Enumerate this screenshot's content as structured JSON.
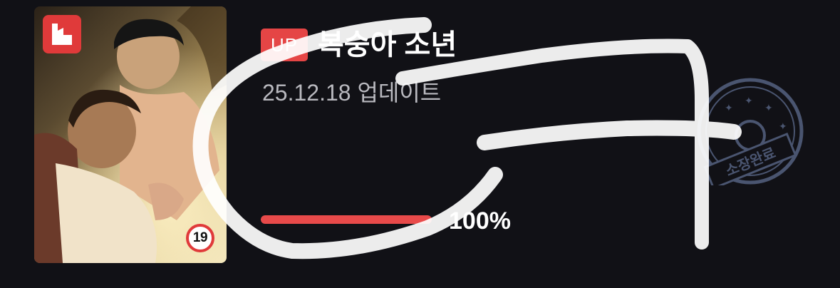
{
  "colors": {
    "background": "#111116",
    "accent": "#e54545",
    "progress": "#e84a4a",
    "stamp": "#4a5570"
  },
  "comic": {
    "logo_icon": "publisher-logo-icon",
    "age_rating": "19",
    "up_badge": "UP",
    "title": "복숭아 소년",
    "updated": "25.12.18 업데이트",
    "progress_percent": 100,
    "progress_label": "100%",
    "stamp_icon": "collection-complete-stamp-icon",
    "stamp_text": "소장완료"
  }
}
